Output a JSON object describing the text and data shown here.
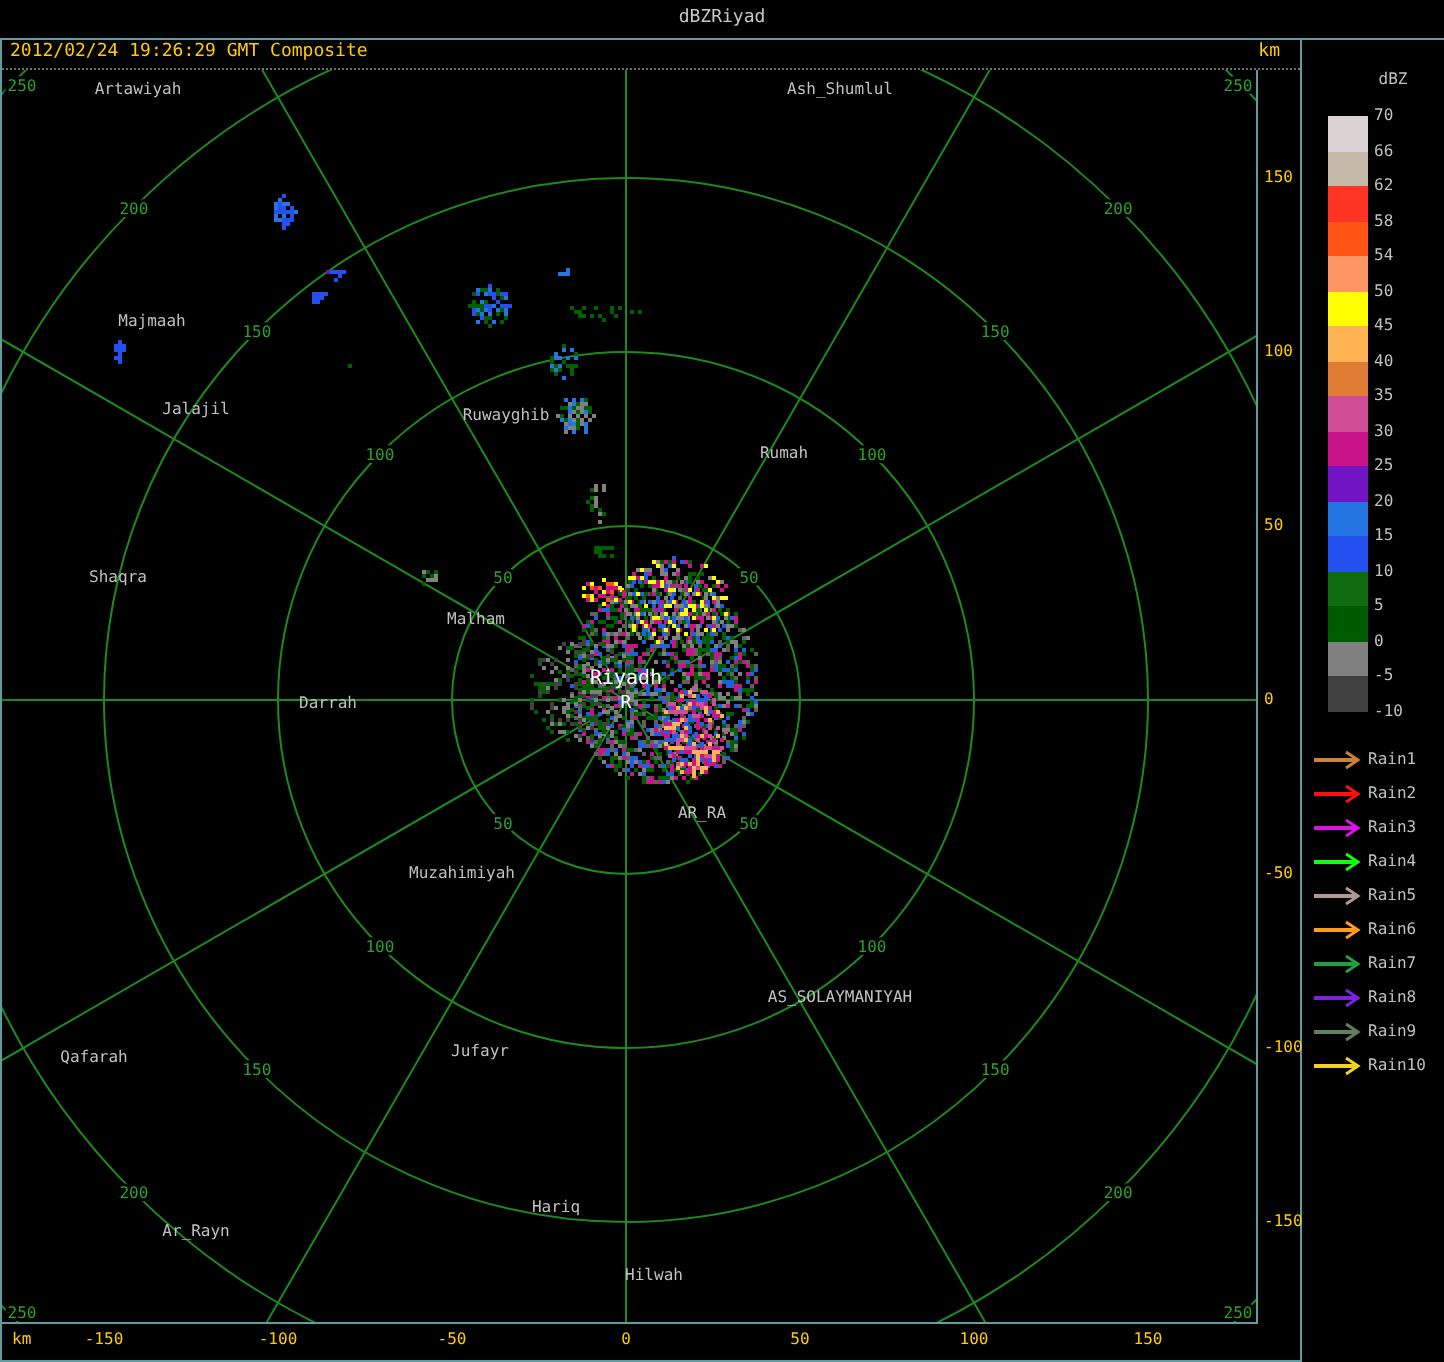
{
  "window": {
    "title": "dBZRiyad"
  },
  "header": {
    "timestamp": "2012/02/24 19:26:29 GMT Composite",
    "unit": "km"
  },
  "map": {
    "rings": [
      {
        "labels": [
          "50",
          "50",
          "50",
          "50"
        ]
      },
      {
        "labels": [
          "100",
          "100",
          "100",
          "100"
        ]
      },
      {
        "labels": [
          "150",
          "150",
          "150",
          "150"
        ]
      },
      {
        "labels": [
          "200",
          "200",
          "200",
          "200"
        ]
      },
      {
        "labels": [
          "250",
          "250",
          "250",
          "250"
        ]
      }
    ],
    "radar_mark": "R",
    "places": [
      {
        "name": "Artawiyah",
        "kind": "town"
      },
      {
        "name": "Ash_Shumlul",
        "kind": "town"
      },
      {
        "name": "Majmaah",
        "kind": "town"
      },
      {
        "name": "Jalajil",
        "kind": "town"
      },
      {
        "name": "Ruwayghib",
        "kind": "town"
      },
      {
        "name": "Rumah",
        "kind": "town"
      },
      {
        "name": "Shaqra",
        "kind": "town"
      },
      {
        "name": "Malham",
        "kind": "town"
      },
      {
        "name": "Riyadh",
        "kind": "site"
      },
      {
        "name": "Darrah",
        "kind": "town"
      },
      {
        "name": "AR_RA",
        "kind": "town"
      },
      {
        "name": "Muzahimiyah",
        "kind": "town"
      },
      {
        "name": "AS_SOLAYMANIYAH",
        "kind": "town"
      },
      {
        "name": "Qafarah",
        "kind": "town"
      },
      {
        "name": "Jufayr",
        "kind": "town"
      },
      {
        "name": "Ar_Rayn",
        "kind": "town"
      },
      {
        "name": "Hariq",
        "kind": "town"
      },
      {
        "name": "Hilwah",
        "kind": "town"
      }
    ]
  },
  "y_axis": {
    "ticks": [
      "150",
      "100",
      "50",
      "0",
      "-50",
      "-100",
      "-150"
    ]
  },
  "x_axis": {
    "unit": "km",
    "ticks": [
      "-150",
      "-100",
      "-50",
      "0",
      "50",
      "100",
      "150"
    ]
  },
  "legend": {
    "unit": "dBZ",
    "scale_labels": [
      "70",
      "66",
      "62",
      "58",
      "54",
      "50",
      "45",
      "40",
      "35",
      "30",
      "25",
      "20",
      "15",
      "10",
      "5",
      "0",
      "-5",
      "-10"
    ],
    "bands": [
      {
        "color": "#dcd4d4"
      },
      {
        "color": "#c4b8a8"
      },
      {
        "color": "#ff3424"
      },
      {
        "color": "#ff5414"
      },
      {
        "color": "#ff9464"
      },
      {
        "color": "#ffff00"
      },
      {
        "color": "#ffb454"
      },
      {
        "color": "#e07c34"
      },
      {
        "color": "#d04c94"
      },
      {
        "color": "#c81488"
      },
      {
        "color": "#7014c4"
      },
      {
        "color": "#2474e4"
      },
      {
        "color": "#2450f0"
      },
      {
        "color": "#106c10"
      },
      {
        "color": "#005c00"
      },
      {
        "color": "#808080"
      },
      {
        "color": "#404040"
      }
    ],
    "tracks": [
      {
        "name": "Rain1",
        "color": "#c8843c"
      },
      {
        "name": "Rain2",
        "color": "#ff1010"
      },
      {
        "name": "Rain3",
        "color": "#e010e0"
      },
      {
        "name": "Rain4",
        "color": "#10ff10"
      },
      {
        "name": "Rain5",
        "color": "#b09898"
      },
      {
        "name": "Rain6",
        "color": "#ff9c20"
      },
      {
        "name": "Rain7",
        "color": "#20a040"
      },
      {
        "name": "Rain8",
        "color": "#8020e0"
      },
      {
        "name": "Rain9",
        "color": "#608060"
      },
      {
        "name": "Rain10",
        "color": "#f0d020"
      }
    ]
  }
}
